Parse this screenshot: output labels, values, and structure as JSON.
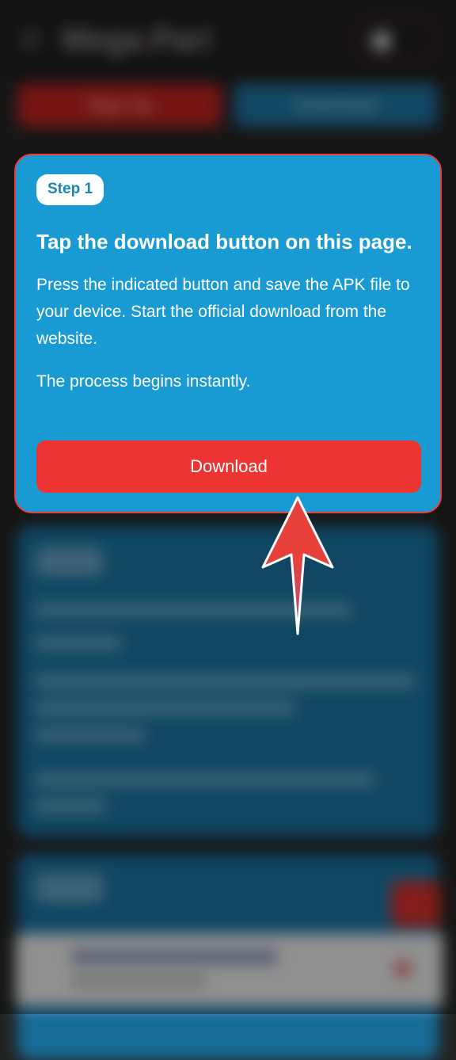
{
  "header": {
    "logo_text": "Mega",
    "logo_text_2": "Pari"
  },
  "top_buttons": {
    "signup_label": "Sign Up",
    "download_label": "Download"
  },
  "step_card": {
    "badge": "Step 1",
    "title": "Tap the download button on this page.",
    "description": "Press the indicated button and save the APK file to your device. Start the official download from the website.",
    "note": "The process begins instantly.",
    "button_label": "Download"
  },
  "icons": {
    "pointer": "up-arrow-icon",
    "menu": "hamburger-menu-icon",
    "user": "user-icon"
  },
  "colors": {
    "card_bg": "#1a9ad2",
    "card_border": "#e8403a",
    "button_bg": "#ee3432",
    "badge_text": "#1a84b8",
    "arrow": "#e8403a"
  }
}
